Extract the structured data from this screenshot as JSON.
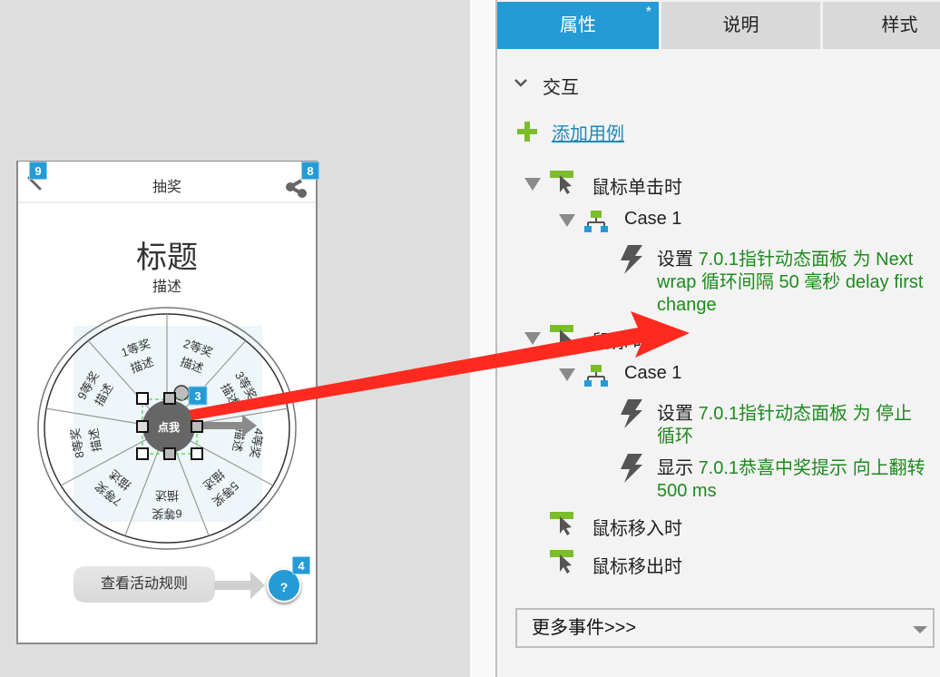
{
  "canvas": {
    "phone": {
      "title": "抽奖",
      "back_badge": "9",
      "share_badge": "8",
      "heading": "标题",
      "subheading": "描述",
      "wheel": {
        "segments": [
          {
            "prize": "1等奖",
            "desc": "描述"
          },
          {
            "prize": "2等奖",
            "desc": "描述"
          },
          {
            "prize": "3等奖",
            "desc": "描述"
          },
          {
            "prize": "4等奖",
            "desc": "描述"
          },
          {
            "prize": "5等奖",
            "desc": "描述"
          },
          {
            "prize": "6等奖",
            "desc": "描述"
          },
          {
            "prize": "7等奖",
            "desc": "描述"
          },
          {
            "prize": "8等奖",
            "desc": "描述"
          },
          {
            "prize": "9等奖",
            "desc": "描述"
          }
        ],
        "center_button": "点我",
        "center_badge": "3"
      },
      "rules_button": "查看活动规则",
      "help_button": "?",
      "help_badge": "4"
    }
  },
  "panel": {
    "tabs": [
      {
        "label": "属性",
        "active": true,
        "modified_marker": "*"
      },
      {
        "label": "说明",
        "active": false
      },
      {
        "label": "样式",
        "active": false
      }
    ],
    "section_title": "交互",
    "add_case_label": "添加用例",
    "events": [
      {
        "label": "鼠标单击时",
        "cases": [
          {
            "label": "Case 1",
            "actions": [
              {
                "verb": "设置",
                "detail": "7.0.1指针动态面板 为 Next wrap 循环间隔 50 毫秒 delay first change"
              }
            ]
          }
        ]
      },
      {
        "label": "鼠标  时",
        "cases": [
          {
            "label": "Case 1",
            "actions": [
              {
                "verb": "设置",
                "detail": "7.0.1指针动态面板 为 停止循环"
              },
              {
                "verb": "显示",
                "detail": "7.0.1恭喜中奖提示 向上翻转 500 ms"
              }
            ]
          }
        ]
      },
      {
        "label": "鼠标移入时",
        "cases": []
      },
      {
        "label": "鼠标移出时",
        "cases": []
      }
    ],
    "more_events": "更多事件>>>"
  },
  "colors": {
    "accent": "#259bd6",
    "action_green": "#1e8a1e",
    "event_icon_green": "#7cbd2a",
    "annotation_arrow": "#ff2a1f"
  }
}
